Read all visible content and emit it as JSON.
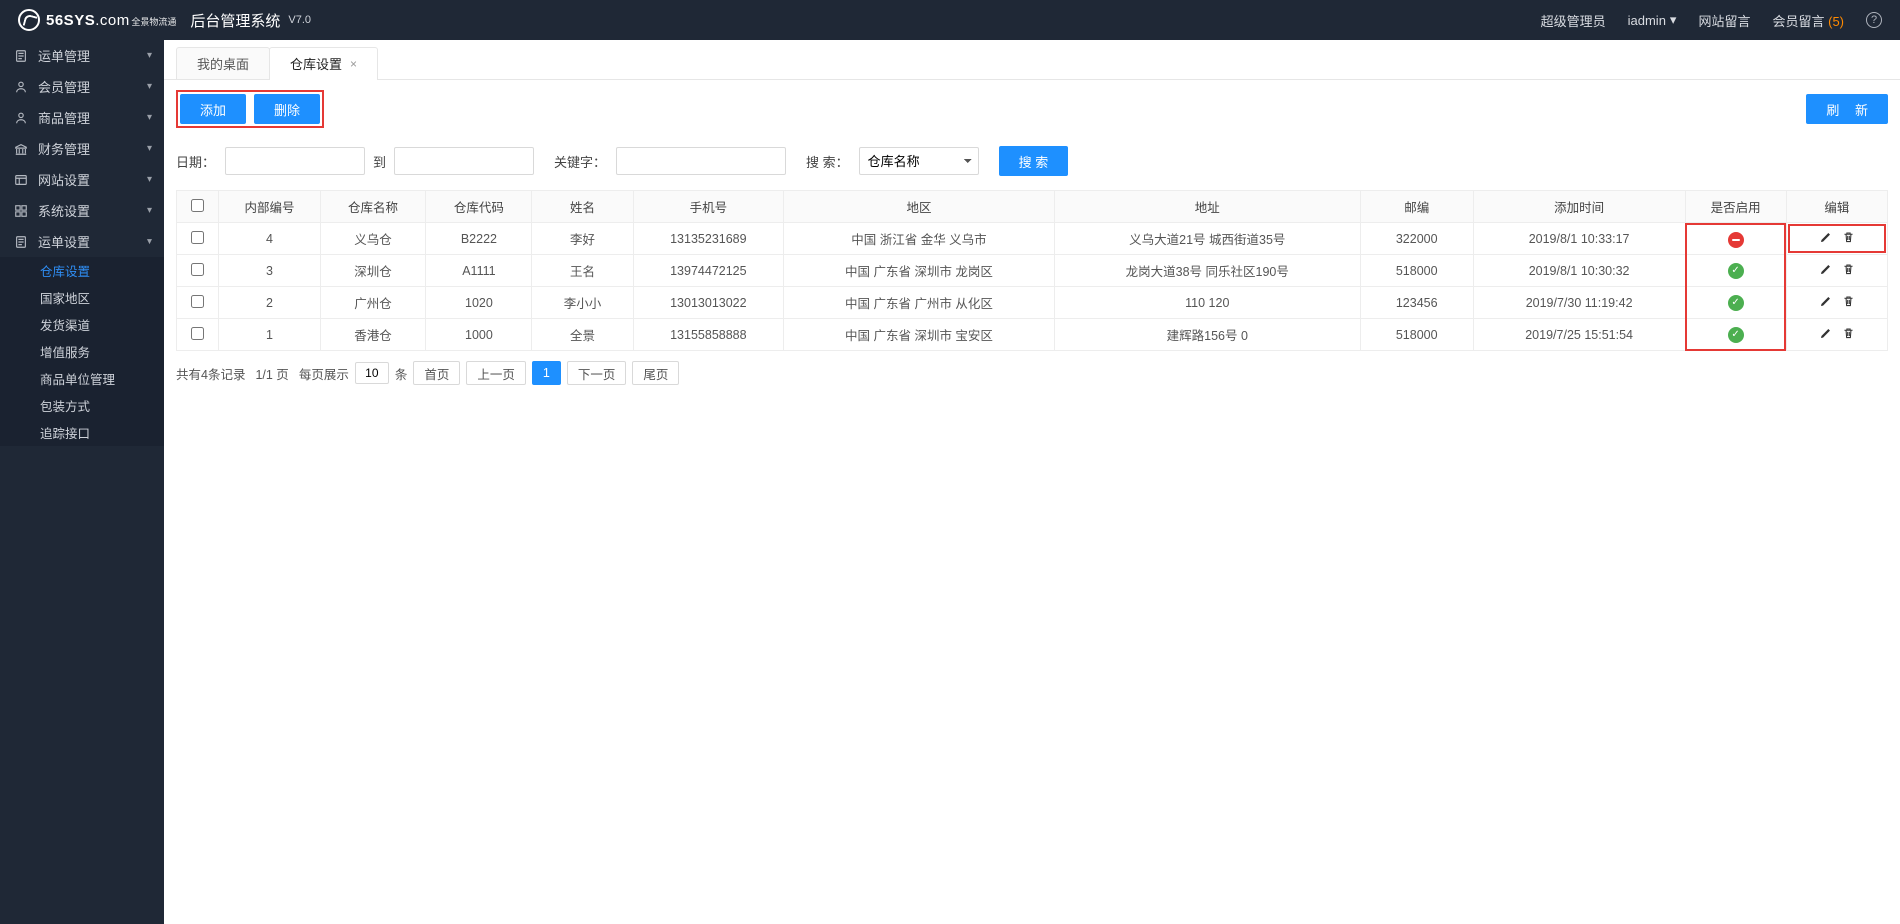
{
  "header": {
    "logo_text": "56SYS",
    "logo_domain": ".com",
    "logo_sub": "全景物流通",
    "title": "后台管理系统",
    "version": "V7.0",
    "role": "超级管理员",
    "user": "iadmin",
    "site_msg": "网站留言",
    "member_msg": "会员留言",
    "member_msg_count": "(5)"
  },
  "sidebar": {
    "items": [
      {
        "label": "运单管理",
        "icon": "doc"
      },
      {
        "label": "会员管理",
        "icon": "user"
      },
      {
        "label": "商品管理",
        "icon": "user"
      },
      {
        "label": "财务管理",
        "icon": "bank"
      },
      {
        "label": "网站设置",
        "icon": "layout"
      },
      {
        "label": "系统设置",
        "icon": "grid"
      },
      {
        "label": "运单设置",
        "icon": "doc",
        "expanded": true
      }
    ],
    "sub": [
      {
        "label": "仓库设置",
        "active": true
      },
      {
        "label": "国家地区"
      },
      {
        "label": "发货渠道"
      },
      {
        "label": "增值服务"
      },
      {
        "label": "商品单位管理"
      },
      {
        "label": "包装方式"
      },
      {
        "label": "追踪接口"
      }
    ]
  },
  "tabs": [
    {
      "label": "我的桌面",
      "closable": false
    },
    {
      "label": "仓库设置",
      "closable": true,
      "active": true
    }
  ],
  "toolbar": {
    "add": "添加",
    "delete": "删除",
    "refresh": "刷 新"
  },
  "search": {
    "date_label": "日期：",
    "to": "到",
    "kw_label": "关键字：",
    "search_label": "搜 索：",
    "field_selected": "仓库名称",
    "btn": "搜 索"
  },
  "table": {
    "headers": {
      "id": "内部编号",
      "name": "仓库名称",
      "code": "仓库代码",
      "person": "姓名",
      "phone": "手机号",
      "region": "地区",
      "address": "地址",
      "zip": "邮编",
      "time": "添加时间",
      "enabled": "是否启用",
      "edit": "编辑"
    },
    "rows": [
      {
        "id": "4",
        "name": "义乌仓",
        "code": "B2222",
        "person": "李好",
        "phone": "13135231689",
        "region": "中国 浙江省 金华 义乌市",
        "address": "义乌大道21号 城西街道35号",
        "zip": "322000",
        "time": "2019/8/1 10:33:17",
        "enabled": false,
        "row_highlight": true
      },
      {
        "id": "3",
        "name": "深圳仓",
        "code": "A1111",
        "person": "王名",
        "phone": "13974472125",
        "region": "中国 广东省 深圳市 龙岗区",
        "address": "龙岗大道38号 同乐社区190号",
        "zip": "518000",
        "time": "2019/8/1 10:30:32",
        "enabled": true
      },
      {
        "id": "2",
        "name": "广州仓",
        "code": "1020",
        "person": "李小小",
        "phone": "13013013022",
        "region": "中国 广东省 广州市 从化区",
        "address": "110 120",
        "zip": "123456",
        "time": "2019/7/30 11:19:42",
        "enabled": true
      },
      {
        "id": "1",
        "name": "香港仓",
        "code": "1000",
        "person": "全景",
        "phone": "13155858888",
        "region": "中国 广东省 深圳市 宝安区",
        "address": "建辉路156号 0",
        "zip": "518000",
        "time": "2019/7/25 15:51:54",
        "enabled": true
      }
    ]
  },
  "pager": {
    "summary_a": "共有4条记录",
    "summary_b": "1/1 页",
    "per_page_label_a": "每页展示",
    "per_page_value": "10",
    "per_page_label_b": "条",
    "first": "首页",
    "prev": "上一页",
    "current": "1",
    "next": "下一页",
    "last": "尾页"
  }
}
